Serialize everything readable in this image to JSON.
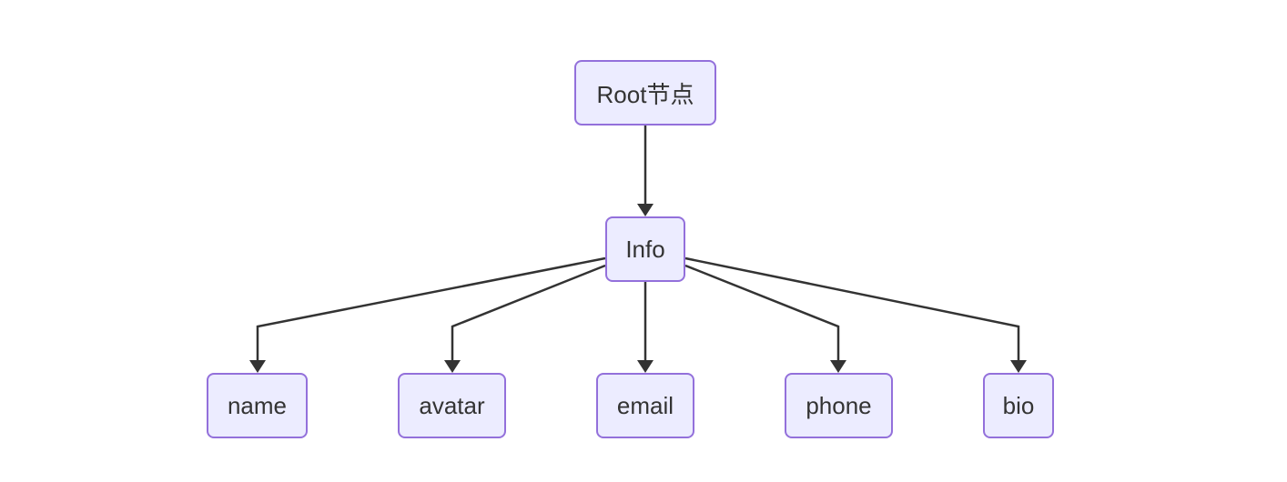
{
  "diagram": {
    "type": "flowchart",
    "direction": "top-down",
    "colors": {
      "node_fill": "#ECECFF",
      "node_border": "#9370DB",
      "edge": "#333333",
      "text": "#333333",
      "background": "#FFFFFF"
    },
    "nodes": {
      "root": "Root节点",
      "info": "Info",
      "name": "name",
      "avatar": "avatar",
      "email": "email",
      "phone": "phone",
      "bio": "bio"
    },
    "edges": [
      {
        "from": "root",
        "to": "info"
      },
      {
        "from": "info",
        "to": "name"
      },
      {
        "from": "info",
        "to": "avatar"
      },
      {
        "from": "info",
        "to": "email"
      },
      {
        "from": "info",
        "to": "phone"
      },
      {
        "from": "info",
        "to": "bio"
      }
    ]
  }
}
